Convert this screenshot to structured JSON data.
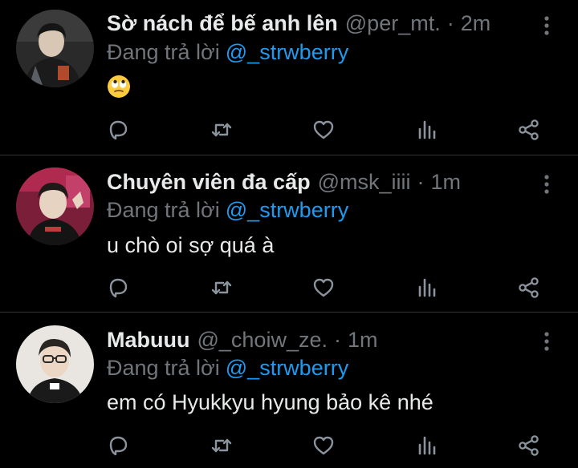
{
  "colors": {
    "background": "#000000",
    "text_primary": "#e7e9ea",
    "text_secondary": "#71767b",
    "accent": "#1d9bf0",
    "divider": "#2f3336"
  },
  "tweets": [
    {
      "display_name": "Sờ nách để bế anh lên",
      "handle": "@per_mt.",
      "separator": "·",
      "time": "2m",
      "reply_prefix": "Đang trả lời",
      "reply_to": "@_strwberry",
      "text": "",
      "emoji": "face-with-rolling-eyes",
      "actions": [
        "reply-icon",
        "retweet-icon",
        "like-icon",
        "stats-icon",
        "share-icon"
      ]
    },
    {
      "display_name": "Chuyên viên đa cấp",
      "handle": "@msk_iiii",
      "separator": "·",
      "time": "1m",
      "reply_prefix": "Đang trả lời",
      "reply_to": "@_strwberry",
      "text": "u chò oi sợ quá à",
      "actions": [
        "reply-icon",
        "retweet-icon",
        "like-icon",
        "stats-icon",
        "share-icon"
      ]
    },
    {
      "display_name": "Mabuuu",
      "handle": "@_choiw_ze.",
      "separator": "·",
      "time": "1m",
      "reply_prefix": "Đang trả lời",
      "reply_to": "@_strwberry",
      "text": "em có Hyukkyu hyung bảo kê nhé",
      "actions": [
        "reply-icon",
        "retweet-icon",
        "like-icon",
        "stats-icon",
        "share-icon"
      ]
    }
  ]
}
